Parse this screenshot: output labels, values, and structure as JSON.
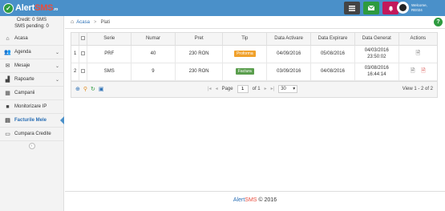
{
  "header": {
    "logo_text": "Alert",
    "logo_sms": "SMS",
    "logo_ro": ".ro",
    "user_welcome": "Welcome,",
    "user_name": "RE024"
  },
  "sidebar": {
    "credit": "Credit: 0 SMS",
    "pending": "SMS pending: 0",
    "items": [
      {
        "label": "Acasa",
        "icon": "home-icon",
        "chevron": false
      },
      {
        "label": "Agenda",
        "icon": "users-icon",
        "chevron": true
      },
      {
        "label": "Mesaje",
        "icon": "envelope-icon",
        "chevron": true
      },
      {
        "label": "Rapoarte",
        "icon": "chart-icon",
        "chevron": true
      },
      {
        "label": "Campanii",
        "icon": "calendar-icon",
        "chevron": false
      },
      {
        "label": "Monitorizare IP",
        "icon": "camera-icon",
        "chevron": false
      },
      {
        "label": "Facturile Mele",
        "icon": "invoice-icon",
        "chevron": false,
        "active": true
      },
      {
        "label": "Cumpara Credite",
        "icon": "credit-card-icon",
        "chevron": false
      }
    ]
  },
  "breadcrumb": {
    "home": "Acasa",
    "current": "Plati"
  },
  "table": {
    "columns": [
      "Serie",
      "Numar",
      "Pret",
      "Tip",
      "Data Activare",
      "Data Expirare",
      "Data Generat",
      "Actions"
    ],
    "rows": [
      {
        "idx": "1",
        "serie": "PRF",
        "numar": "40",
        "pret": "230 RON",
        "tip": "Proforma",
        "activare": "04/09/2016",
        "expirare": "05/08/2016",
        "generat1": "04/03/2016",
        "generat2": "23:50:02"
      },
      {
        "idx": "2",
        "serie": "SMS",
        "numar": "9",
        "pret": "230 RON",
        "tip": "Factura",
        "activare": "03/09/2016",
        "expirare": "04/08/2016",
        "generat1": "03/08/2016",
        "generat2": "16:44:14"
      }
    ]
  },
  "pager": {
    "page_label": "Page",
    "page_value": "1",
    "of_label": "of 1",
    "rows_value": "30",
    "view": "View 1 - 2 of 2"
  },
  "footer": {
    "alert": "Alert",
    "sms": "SMS",
    "copy": "© 2016"
  },
  "colors": {
    "topbar": "#4a90c9",
    "btn_dark": "#444444",
    "btn_green": "#2e9b3f",
    "btn_red": "#c2185b",
    "proforma": "#f0a12c",
    "factura": "#5a9e4d"
  }
}
